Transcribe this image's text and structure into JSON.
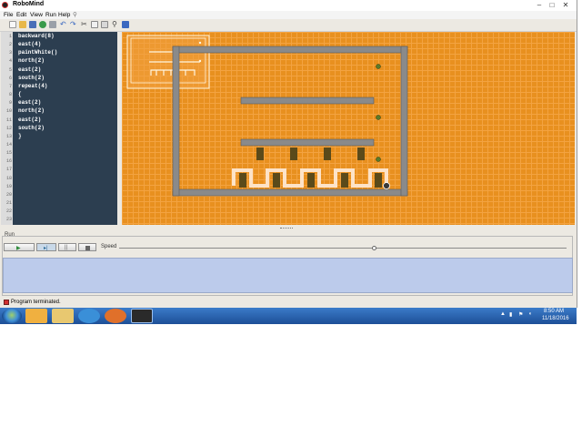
{
  "window": {
    "title": "RoboMind"
  },
  "menu": [
    "File",
    "Edit",
    "View",
    "Run",
    "Help"
  ],
  "editor": {
    "line_numbers": [
      "1",
      "2",
      "3",
      "4",
      "5",
      "6",
      "7",
      "8",
      "9",
      "10",
      "11",
      "12",
      "13",
      "14",
      "15",
      "16",
      "17",
      "18",
      "19",
      "20",
      "21",
      "22",
      "23",
      "24"
    ],
    "code_lines": [
      "backward(8)",
      "east(4)",
      "paintWhite()",
      "north(2)",
      "east(2)",
      "south(2)",
      "repeat(4)",
      "{",
      "east(2)",
      "north(2)",
      "east(2)",
      "south(2)",
      "}"
    ]
  },
  "run": {
    "group_label": "Run",
    "speed_label": "Speed",
    "speed_fraction": 0.57
  },
  "status": {
    "text": "Program terminated."
  },
  "taskbar": {
    "time": "8:50 AM",
    "date": "11/18/2016"
  },
  "colors": {
    "world_background": "#e8901f",
    "wall": "#8a8a8a",
    "paint_white": "#fde3c8",
    "editor_background": "#2c3e50",
    "output_background": "#bccbeb",
    "taskbar": "#1d4f97"
  }
}
